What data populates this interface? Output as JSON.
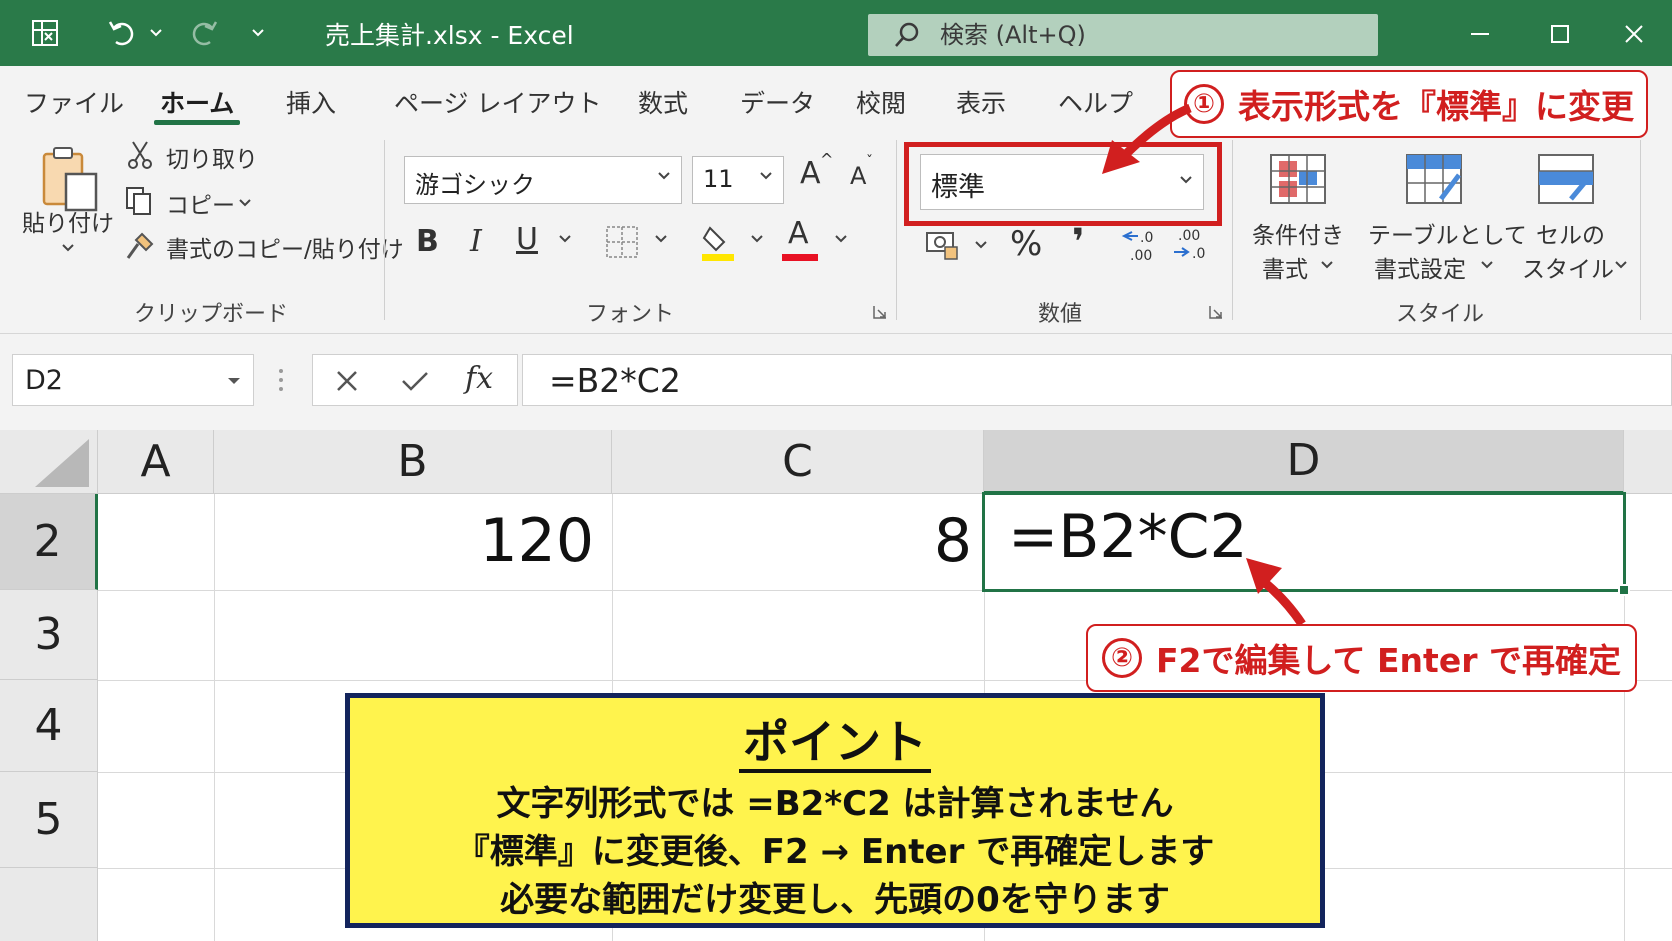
{
  "titlebar": {
    "doc_title": "売上集計.xlsx  -  Excel",
    "search_placeholder": "検索 (Alt+Q)",
    "icons": [
      "excel-icon",
      "undo-icon",
      "redo-icon",
      "customize-icon",
      "search-icon",
      "minimize-icon",
      "maximize-icon",
      "close-icon"
    ]
  },
  "tabs": [
    {
      "label": "ファイル"
    },
    {
      "label": "ホーム",
      "active": true
    },
    {
      "label": "挿入"
    },
    {
      "label": "ページ レイアウト"
    },
    {
      "label": "数式"
    },
    {
      "label": "データ"
    },
    {
      "label": "校閲"
    },
    {
      "label": "表示"
    },
    {
      "label": "ヘルプ"
    }
  ],
  "ribbon": {
    "clipboard": {
      "paste": "貼り付け",
      "cut": "切り取り",
      "copy": "コピー",
      "format_painter": "書式のコピー/貼り付け",
      "group": "クリップボード"
    },
    "font": {
      "font_name": "游ゴシック",
      "font_size": "11",
      "grow": "A",
      "shrink": "A",
      "bold": "B",
      "italic": "I",
      "underline": "U",
      "font_color": "A",
      "group": "フォント",
      "accent_fill": "#ffe600",
      "accent_font": "#e81123"
    },
    "number": {
      "format": "標準",
      "percent": "%",
      "comma": "❜",
      "inc_decimal": ".00",
      "dec_decimal": ".0",
      "group": "数値"
    },
    "styles": {
      "conditional": [
        "条件付き",
        "書式"
      ],
      "table": [
        "テーブルとして",
        "書式設定"
      ],
      "cell_style": [
        "セルの",
        "スタイル"
      ],
      "group": "スタイル"
    }
  },
  "formula_bar": {
    "name_box": "D2",
    "fx": "fx",
    "formula": "=B2*C2"
  },
  "sheet": {
    "columns": [
      "A",
      "B",
      "C",
      "D"
    ],
    "rows": [
      "2",
      "3",
      "4",
      "5"
    ],
    "cells": {
      "B2": "120",
      "C2": "8",
      "D2": "=B2*C2"
    },
    "active_cell": "D2",
    "accent": "#217346"
  },
  "callouts": {
    "one": {
      "num": "①",
      "text": "表示形式を『標準』に変更"
    },
    "two": {
      "num": "②",
      "text": "F2で編集して Enter で再確定"
    },
    "color": "#d11f1f"
  },
  "point": {
    "title": "ポイント",
    "lines": [
      "文字列形式では =B2*C2 は計算されません",
      "『標準』に変更後、F2 → Enter で再確定します",
      "必要な範囲だけ変更し、先頭の0を守ります"
    ],
    "bg": "#fff34d",
    "border": "#13245c"
  }
}
